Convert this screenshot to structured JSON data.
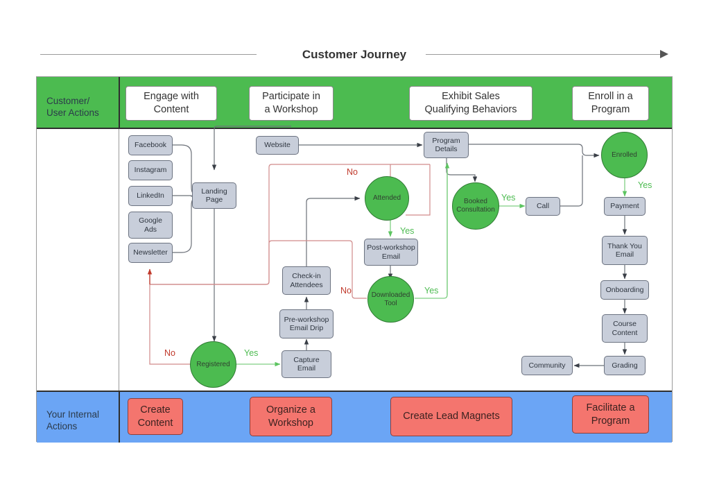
{
  "title": {
    "text": "Customer Journey",
    "arrow_icon": "right-arrow-icon"
  },
  "lanes": {
    "top": {
      "label": "Customer/\nUser Actions",
      "label_line1": "Customer/",
      "label_line2": "User Actions",
      "color": "#4CBB50",
      "stages": [
        {
          "id": "engage",
          "label": "Engage with\nContent",
          "line1": "Engage with",
          "line2": "Content"
        },
        {
          "id": "workshop",
          "label": "Participate in\na Workshop",
          "line1": "Participate in",
          "line2": "a Workshop"
        },
        {
          "id": "qualify",
          "label": "Exhibit Sales\nQualifying Behaviors",
          "line1": "Exhibit Sales",
          "line2": "Qualifying Behaviors"
        },
        {
          "id": "enroll",
          "label": "Enroll in a\nProgram",
          "line1": "Enroll in a",
          "line2": "Program"
        }
      ]
    },
    "bottom": {
      "label": "Your Internal\nActions",
      "label_line1": "Your Internal",
      "label_line2": "Actions",
      "color": "#6BA5F5",
      "actions": [
        {
          "id": "create-content",
          "label": "Create\nContent",
          "line1": "Create",
          "line2": "Content"
        },
        {
          "id": "organize-workshop",
          "label": "Organize a\nWorkshop",
          "line1": "Organize a",
          "line2": "Workshop"
        },
        {
          "id": "lead-magnets",
          "label": "Create Lead Magnets",
          "line1": "Create Lead Magnets",
          "line2": ""
        },
        {
          "id": "facilitate",
          "label": "Facilitate a\nProgram",
          "line1": "Facilitate a",
          "line2": "Program"
        }
      ]
    }
  },
  "flow": {
    "node_fill": "#C8CEDA",
    "decision_fill": "#4CBB50",
    "yes_color": "#4CBB50",
    "no_color": "#C0392B",
    "nodes": [
      {
        "id": "facebook",
        "label": "Facebook",
        "type": "process",
        "line1": "Facebook",
        "line2": ""
      },
      {
        "id": "instagram",
        "label": "Instagram",
        "type": "process",
        "line1": "Instagram",
        "line2": ""
      },
      {
        "id": "linkedin",
        "label": "LinkedIn",
        "type": "process",
        "line1": "LinkedIn",
        "line2": ""
      },
      {
        "id": "google-ads",
        "label": "Google Ads",
        "type": "process",
        "line1": "Google",
        "line2": "Ads"
      },
      {
        "id": "newsletter",
        "label": "Newsletter",
        "type": "process",
        "line1": "Newsletter",
        "line2": ""
      },
      {
        "id": "website",
        "label": "Website",
        "type": "process",
        "line1": "Website",
        "line2": ""
      },
      {
        "id": "landing-page",
        "label": "Landing Page",
        "type": "process",
        "line1": "Landing",
        "line2": "Page"
      },
      {
        "id": "registered",
        "label": "Registered",
        "type": "decision",
        "line1": "Registered",
        "line2": ""
      },
      {
        "id": "capture-email",
        "label": "Capture Email",
        "type": "process",
        "line1": "Capture",
        "line2": "Email"
      },
      {
        "id": "pre-workshop",
        "label": "Pre-workshop Email Drip",
        "type": "process",
        "line1": "Pre-workshop",
        "line2": "Email Drip"
      },
      {
        "id": "check-in",
        "label": "Check-in Attendees",
        "type": "process",
        "line1": "Check-in",
        "line2": "Attendees"
      },
      {
        "id": "attended",
        "label": "Attended",
        "type": "decision",
        "line1": "Attended",
        "line2": ""
      },
      {
        "id": "post-workshop",
        "label": "Post-workshop Email",
        "type": "process",
        "line1": "Post-workshop",
        "line2": "Email"
      },
      {
        "id": "downloaded",
        "label": "Downloaded Tool",
        "type": "decision",
        "line1": "Downloaded",
        "line2": "Tool"
      },
      {
        "id": "program-details",
        "label": "Program Details",
        "type": "process",
        "line1": "Program",
        "line2": "Details"
      },
      {
        "id": "booked",
        "label": "Booked Consultation",
        "type": "decision",
        "line1": "Booked",
        "line2": "Consultation"
      },
      {
        "id": "call",
        "label": "Call",
        "type": "process",
        "line1": "Call",
        "line2": ""
      },
      {
        "id": "enrolled",
        "label": "Enrolled",
        "type": "decision",
        "line1": "Enrolled",
        "line2": ""
      },
      {
        "id": "payment",
        "label": "Payment",
        "type": "process",
        "line1": "Payment",
        "line2": ""
      },
      {
        "id": "thank-you",
        "label": "Thank You Email",
        "type": "process",
        "line1": "Thank You",
        "line2": "Email"
      },
      {
        "id": "onboarding",
        "label": "Onboarding",
        "type": "process",
        "line1": "Onboarding",
        "line2": ""
      },
      {
        "id": "course-content",
        "label": "Course Content",
        "type": "process",
        "line1": "Course",
        "line2": "Content"
      },
      {
        "id": "grading",
        "label": "Grading",
        "type": "process",
        "line1": "Grading",
        "line2": ""
      },
      {
        "id": "community",
        "label": "Community",
        "type": "process",
        "line1": "Community",
        "line2": ""
      }
    ],
    "edge_labels": [
      {
        "id": "no-attended",
        "text": "No",
        "kind": "no"
      },
      {
        "id": "yes-attended",
        "text": "Yes",
        "kind": "yes"
      },
      {
        "id": "no-downloaded",
        "text": "No",
        "kind": "no"
      },
      {
        "id": "yes-downloaded",
        "text": "Yes",
        "kind": "yes"
      },
      {
        "id": "no-registered",
        "text": "No",
        "kind": "no"
      },
      {
        "id": "yes-registered",
        "text": "Yes",
        "kind": "yes"
      },
      {
        "id": "yes-booked",
        "text": "Yes",
        "kind": "yes"
      },
      {
        "id": "yes-enrolled",
        "text": "Yes",
        "kind": "yes"
      }
    ]
  }
}
